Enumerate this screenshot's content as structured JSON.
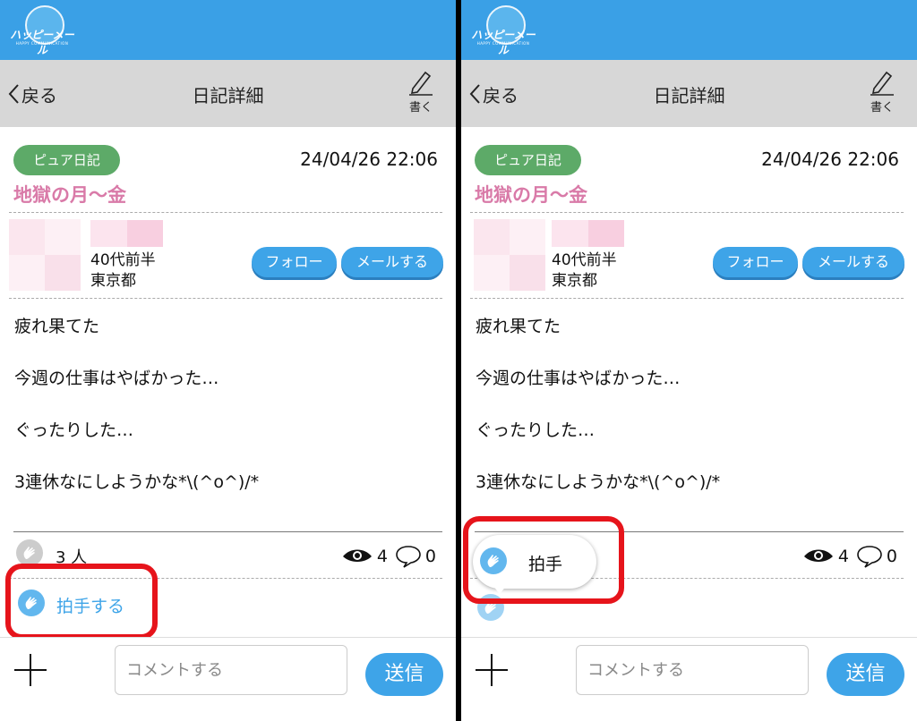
{
  "app": {
    "logo_text": "ハッピーメール",
    "logo_sub": "HAPPY COMMUNICATION"
  },
  "nav": {
    "back_label": "戻る",
    "title": "日記詳細",
    "write_label": "書く"
  },
  "diary": {
    "badge": "ピュア日記",
    "datetime": "24/04/26 22:06",
    "title": "地獄の月～金",
    "author": {
      "age": "40代前半",
      "area": "東京都"
    },
    "follow_label": "フォロー",
    "mail_label": "メールする",
    "body": [
      "疲れ果てた",
      "今週の仕事はやばかった…",
      "ぐったりした…",
      "3連休なにしようかな*\\(^o^)/*"
    ],
    "clap_count": "3 人",
    "views": "4",
    "comments": "0",
    "clap_action_label": "拍手する",
    "clap_popup_label": "拍手"
  },
  "footer": {
    "comment_placeholder": "コメントする",
    "send_label": "送信"
  },
  "colors": {
    "brand_blue": "#3aa0e6",
    "button_blue": "#3ea4e8",
    "badge_green": "#5daa68",
    "title_pink": "#d97aa8",
    "highlight_red": "#e6141b"
  }
}
